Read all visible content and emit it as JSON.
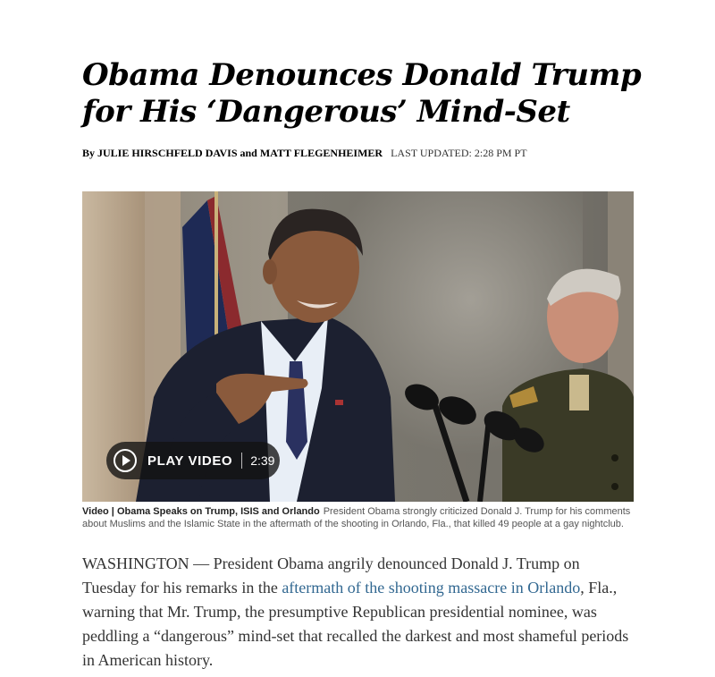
{
  "article": {
    "headline": "Obama Denounces Donald Trump for His ‘Dangerous’ Mind-Set",
    "byline": {
      "authors": "By JULIE HIRSCHFELD DAVIS and MATT FLEGENHEIMER",
      "updated": "LAST UPDATED: 2:28 PM PT"
    },
    "video": {
      "play_label": "PLAY VIDEO",
      "duration": "2:39"
    },
    "caption": {
      "label": "Video | Obama Speaks on Trump, ISIS and Orlando",
      "text": "President Obama strongly criticized Donald J. Trump for his comments about Muslims and the Islamic State in the aftermath of the shooting in Orlando, Fla., that killed 49 people at a gay nightclub."
    },
    "body": {
      "before_link": "WASHINGTON — President Obama angrily denounced Donald J. Trump on Tuesday for his remarks in the ",
      "link": "aftermath of the shooting massacre in Orlando",
      "after_link": ", Fla., warning that Mr. Trump, the presumptive Republican presidential nominee, was peddling a “dangerous” mind-set that recalled the darkest and most shameful periods in American history."
    }
  },
  "colors": {
    "link": "#326891",
    "text": "#333333",
    "caption": "#555555"
  }
}
